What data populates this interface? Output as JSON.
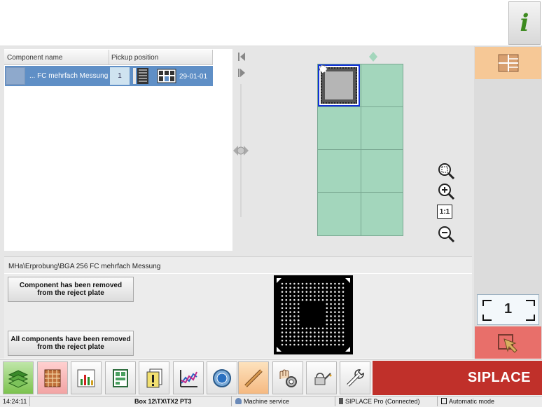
{
  "top": {
    "info_icon": "info-icon",
    "info_glyph": "i"
  },
  "table": {
    "headers": [
      "Component name",
      "Pickup position"
    ],
    "rows": [
      {
        "name": "... FC mehrfach Messung",
        "quantity": "1",
        "position": "29-01-01"
      }
    ]
  },
  "bottom_panel": {
    "path": "MHa\\Erprobung\\BGA 256 FC mehrfach Messung",
    "button_removed_line1": "Component has been removed",
    "button_removed_line2": "from the reject plate",
    "button_all_removed_line1": "All components have been removed",
    "button_all_removed_line2": "from the reject plate"
  },
  "right_column": {
    "counter": "1"
  },
  "zoom_icons": [
    "zoom-fit-icon",
    "zoom-in-icon",
    "zoom-1to1-icon",
    "zoom-out-icon"
  ],
  "zoom_1to1_label": "1:1",
  "toolbar": {
    "icons": [
      "stack-icon",
      "matrix-icon",
      "bar-chart-icon",
      "layout-icon",
      "warning-icon",
      "trend-chart-icon",
      "camera-icon",
      "nozzle-icon",
      "hand-gear-icon",
      "oil-can-icon",
      "wrench-icon"
    ],
    "brand": "SIPLACE"
  },
  "status_bar": {
    "time": "14:24:11",
    "location": "Box 12\\TX\\TX2 PT3",
    "user": "Machine service",
    "connection": "SIPLACE Pro (Connected)",
    "mode": "Automatic mode"
  },
  "colors": {
    "selection_row": "#5f8fc6",
    "board": "#a3d6bc",
    "brand_red": "#c0302a",
    "highlight_orange": "#f6c896",
    "eject_red": "#e86f6a"
  }
}
